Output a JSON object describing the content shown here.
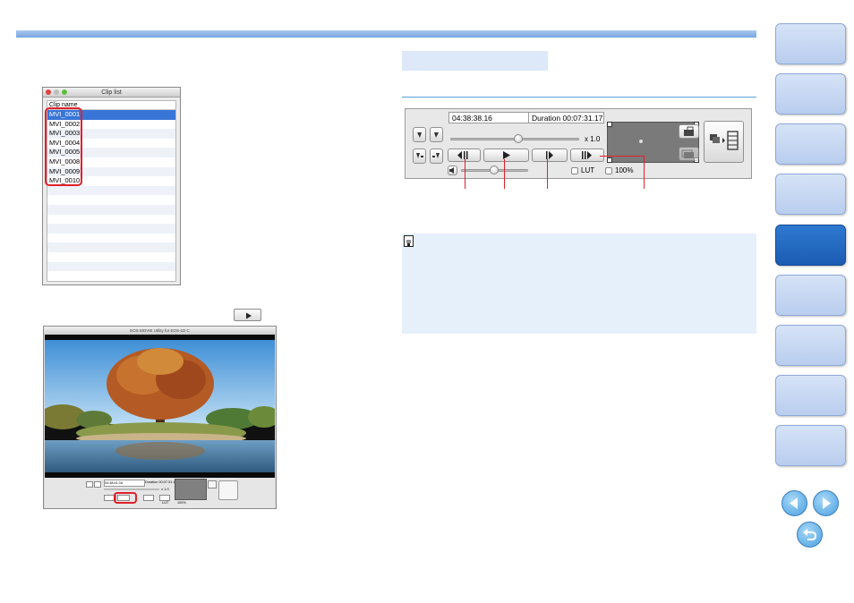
{
  "clip_list": {
    "window_title": "Clip list",
    "header": "Clip name",
    "items": [
      "MVI_0001",
      "MVI_0002",
      "MVI_0003",
      "MVI_0004",
      "MVI_0005",
      "MVI_0008",
      "MVI_0009",
      "MVI_0010"
    ]
  },
  "movie_window": {
    "title": "EOS MOVIE Utility for EOS-1D C",
    "timecode": "04:38:41:16",
    "duration": "Duration 00:07:31.17",
    "speed": "x 1.0",
    "lut": "LUT",
    "zoom": "100%"
  },
  "player": {
    "timecode": "04:38:38.16",
    "duration": "Duration 00:07:31.17",
    "speed": "x 1.0",
    "lut_label": "LUT",
    "zoom_label": "100%"
  },
  "colors": {
    "accent_blue": "#7aa6e0",
    "highlight_red": "#e0202a",
    "nav_active": "#2f79d0",
    "memo_bg": "#e6f0fb"
  },
  "icons": {
    "prev_frame": "prev-frame-icon",
    "play": "play-icon",
    "next_frame": "next-frame-icon",
    "next_fast": "fast-forward-icon",
    "volume": "speaker-icon",
    "memo": "memo-icon",
    "nav_prev": "arrow-left-icon",
    "nav_next": "arrow-right-icon",
    "nav_back": "return-icon"
  }
}
